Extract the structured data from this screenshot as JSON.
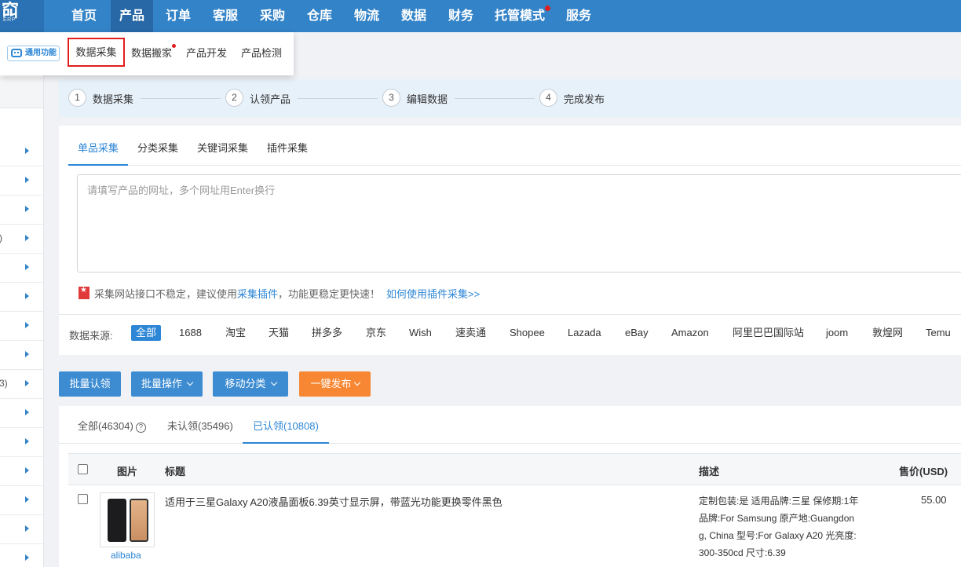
{
  "logo": {
    "glyph": "䆗",
    "sub": "ERP"
  },
  "nav": {
    "items": [
      {
        "label": "首页"
      },
      {
        "label": "产品"
      },
      {
        "label": "订单"
      },
      {
        "label": "客服"
      },
      {
        "label": "采购"
      },
      {
        "label": "仓库"
      },
      {
        "label": "物流"
      },
      {
        "label": "数据"
      },
      {
        "label": "财务"
      },
      {
        "label": "托管模式"
      },
      {
        "label": "服务"
      }
    ]
  },
  "submenu": {
    "badge": "通用功能",
    "items": [
      {
        "label": "数据采集"
      },
      {
        "label": "数据搬家"
      },
      {
        "label": "产品开发"
      },
      {
        "label": "产品检测"
      }
    ]
  },
  "sidebar": {
    "fragments": [
      ")",
      "3)"
    ]
  },
  "steps": [
    {
      "num": "1",
      "label": "数据采集"
    },
    {
      "num": "2",
      "label": "认领产品"
    },
    {
      "num": "3",
      "label": "编辑数据"
    },
    {
      "num": "4",
      "label": "完成发布"
    }
  ],
  "collect": {
    "tabs": [
      {
        "label": "单品采集"
      },
      {
        "label": "分类采集"
      },
      {
        "label": "关键词采集"
      },
      {
        "label": "插件采集"
      }
    ],
    "url_placeholder": "请填写产品的网址，多个网址用Enter换行",
    "tip": {
      "text1": "采集网站接口不稳定，建议使用",
      "link1": "采集插件",
      "text2": "，功能更稳定更快速！",
      "link2": "如何使用插件采集>>"
    },
    "source_label": "数据来源:",
    "sources": [
      "全部",
      "1688",
      "淘宝",
      "天猫",
      "拼多多",
      "京东",
      "Wish",
      "速卖通",
      "Shopee",
      "Lazada",
      "eBay",
      "Amazon",
      "阿里巴巴国际站",
      "joom",
      "敦煌网",
      "Temu"
    ]
  },
  "actions": {
    "claim": "批量认领",
    "bulk": "批量操作",
    "move": "移动分类",
    "publish": "一键发布"
  },
  "list": {
    "tabs": [
      {
        "label": "全部(46304)"
      },
      {
        "label": "未认领(35496)"
      },
      {
        "label": "已认领(10808)"
      }
    ],
    "help": "?",
    "columns": {
      "image": "图片",
      "title": "标题",
      "desc": "描述",
      "price": "售价(USD)"
    },
    "rows": [
      {
        "source": "alibaba",
        "title": "适用于三星Galaxy A20液晶面板6.39英寸显示屏，带蓝光功能更换零件黑色",
        "desc": "定制包装:是 适用品牌:三星 保修期:1年 品牌:For Samsung 原产地:Guangdong, China 型号:For Galaxy A20 光亮度:300-350cd 尺寸:6.39",
        "price": "55.00"
      }
    ]
  },
  "colors": {
    "nav": "#3383c8",
    "accent": "#2d86d6",
    "publish": "#f78733",
    "highlight": "#e21e1e"
  }
}
